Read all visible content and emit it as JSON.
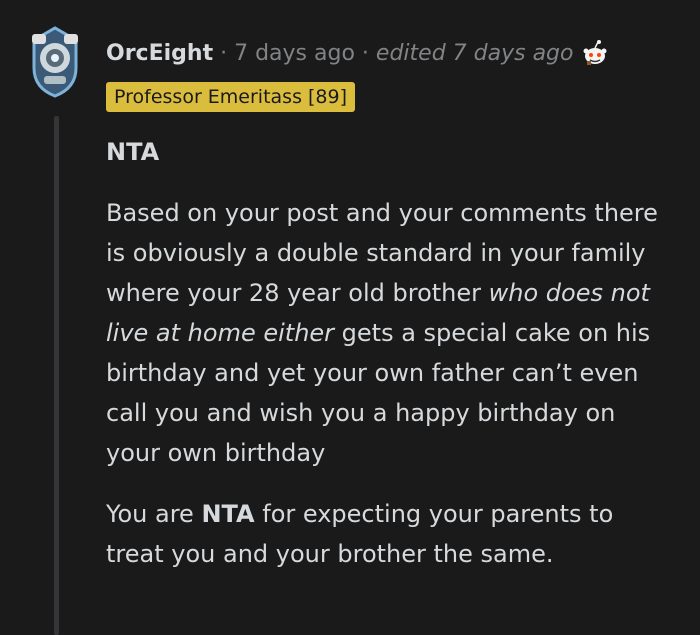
{
  "comment": {
    "author": "OrcEight",
    "separator": "·",
    "time_ago": "7 days ago",
    "edited": "edited 7 days ago",
    "award_icon": "snoo-award-icon",
    "avatar_icon": "robot-avatar-icon",
    "flair": "Professor Emeritass [89]",
    "verdict": "NTA",
    "para1_a": "Based on your post and your comments there is obviously a double standard in your family where your 28 year old brother ",
    "para1_em": "who does not live at home either",
    "para1_b": " gets a special cake on his birthday and yet your own father can’t even call you and wish you a happy birthday on your own birthday",
    "para2_a": "You are ",
    "para2_strong": "NTA",
    "para2_b": " for expecting your parents to treat you and your brother the same."
  },
  "colors": {
    "background": "#1a1a1b",
    "text": "#d7dadc",
    "meta": "#818384",
    "flair_bg": "#dbbd3e",
    "thread_line": "#343536"
  }
}
